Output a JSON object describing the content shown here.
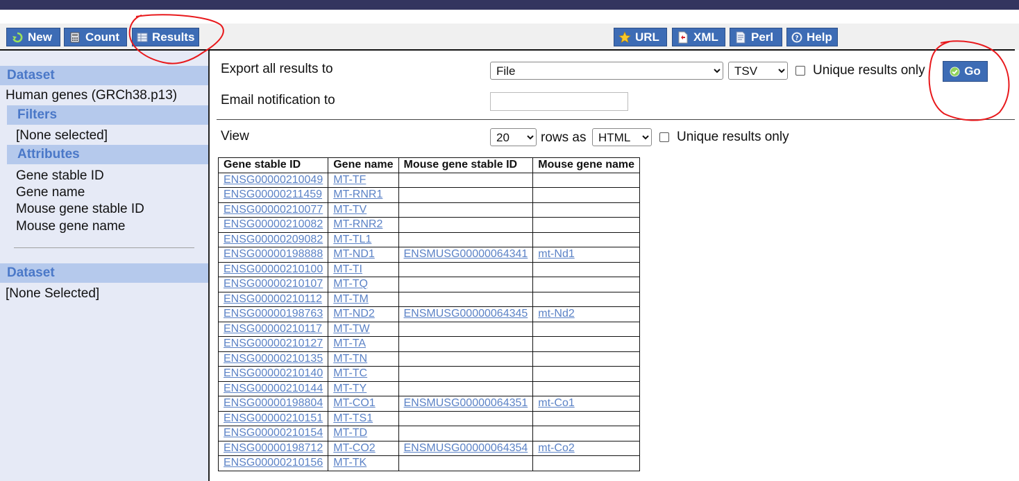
{
  "toolbar": {
    "left_buttons": [
      {
        "label": "New",
        "icon": "refresh-icon"
      },
      {
        "label": "Count",
        "icon": "calculator-icon"
      },
      {
        "label": "Results",
        "icon": "table-icon"
      }
    ],
    "right_buttons": [
      {
        "label": "URL",
        "icon": "star-icon"
      },
      {
        "label": "XML",
        "icon": "xml-icon"
      },
      {
        "label": "Perl",
        "icon": "script-icon"
      },
      {
        "label": "Help",
        "icon": "help-icon"
      }
    ]
  },
  "sidebar": {
    "dataset1_heading": "Dataset",
    "dataset1_value": "Human genes (GRCh38.p13)",
    "filters_heading": "Filters",
    "filters_value": "[None selected]",
    "attributes_heading": "Attributes",
    "attributes": [
      "Gene stable ID",
      "Gene name",
      "Mouse gene stable ID",
      "Mouse gene name"
    ],
    "dataset2_heading": "Dataset",
    "dataset2_value": "[None Selected]"
  },
  "export": {
    "label": "Export  all results to",
    "destination": "File",
    "format": "TSV",
    "unique_label": "Unique results only",
    "go_label": "Go"
  },
  "email": {
    "label": "Email notification to",
    "value": ""
  },
  "view": {
    "label": "View",
    "rows": "20",
    "rows_as_label": "rows as",
    "format": "HTML",
    "unique_label": "Unique results only"
  },
  "table": {
    "headers": [
      "Gene stable ID",
      "Gene name",
      "Mouse gene stable ID",
      "Mouse gene name"
    ],
    "rows": [
      [
        "ENSG00000210049",
        "MT-TF",
        "",
        ""
      ],
      [
        "ENSG00000211459",
        "MT-RNR1",
        "",
        ""
      ],
      [
        "ENSG00000210077",
        "MT-TV",
        "",
        ""
      ],
      [
        "ENSG00000210082",
        "MT-RNR2",
        "",
        ""
      ],
      [
        "ENSG00000209082",
        "MT-TL1",
        "",
        ""
      ],
      [
        "ENSG00000198888",
        "MT-ND1",
        "ENSMUSG00000064341",
        "mt-Nd1"
      ],
      [
        "ENSG00000210100",
        "MT-TI",
        "",
        ""
      ],
      [
        "ENSG00000210107",
        "MT-TQ",
        "",
        ""
      ],
      [
        "ENSG00000210112",
        "MT-TM",
        "",
        ""
      ],
      [
        "ENSG00000198763",
        "MT-ND2",
        "ENSMUSG00000064345",
        "mt-Nd2"
      ],
      [
        "ENSG00000210117",
        "MT-TW",
        "",
        ""
      ],
      [
        "ENSG00000210127",
        "MT-TA",
        "",
        ""
      ],
      [
        "ENSG00000210135",
        "MT-TN",
        "",
        ""
      ],
      [
        "ENSG00000210140",
        "MT-TC",
        "",
        ""
      ],
      [
        "ENSG00000210144",
        "MT-TY",
        "",
        ""
      ],
      [
        "ENSG00000198804",
        "MT-CO1",
        "ENSMUSG00000064351",
        "mt-Co1"
      ],
      [
        "ENSG00000210151",
        "MT-TS1",
        "",
        ""
      ],
      [
        "ENSG00000210154",
        "MT-TD",
        "",
        ""
      ],
      [
        "ENSG00000198712",
        "MT-CO2",
        "ENSMUSG00000064354",
        "mt-Co2"
      ],
      [
        "ENSG00000210156",
        "MT-TK",
        "",
        ""
      ]
    ]
  },
  "colors": {
    "topbar": "#33355f",
    "button": "#3d6cb5",
    "sidebar_bg": "#e6eaf6",
    "section_header": "#b5c9ec",
    "section_text": "#4a78c8",
    "link": "#5b82c6",
    "annotation": "#e8191c"
  }
}
